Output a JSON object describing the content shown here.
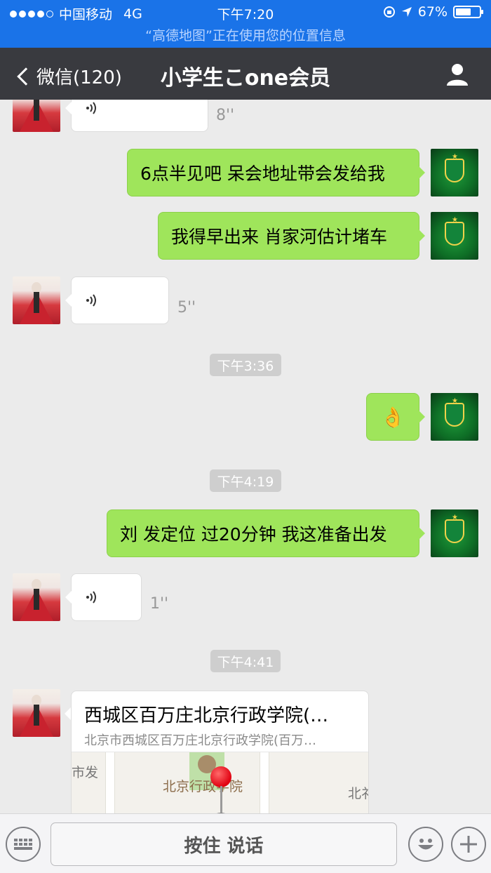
{
  "status_bar": {
    "carrier": "中国移动",
    "network": "4G",
    "time": "下午7:20",
    "battery": "67%",
    "battery_level": 0.67,
    "location_banner": "“高德地图”正在使用您的位置信息"
  },
  "nav": {
    "back_label": "微信(120)",
    "title": "小学生こone会员"
  },
  "messages": [
    {
      "id": "m1",
      "side": "left",
      "kind": "voice",
      "duration": "8''"
    },
    {
      "id": "m2",
      "side": "right",
      "kind": "text",
      "text": "6点半见吧 呆会地址带会发给我"
    },
    {
      "id": "m3",
      "side": "right",
      "kind": "text",
      "text": "我得早出来 肖家河估计堵车"
    },
    {
      "id": "m4",
      "side": "left",
      "kind": "voice",
      "duration": "5''"
    },
    {
      "id": "t1",
      "kind": "time",
      "text": "下午3:36"
    },
    {
      "id": "m5",
      "side": "right",
      "kind": "emoji",
      "text": "👌"
    },
    {
      "id": "t2",
      "kind": "time",
      "text": "下午4:19"
    },
    {
      "id": "m6",
      "side": "right",
      "kind": "text",
      "text": "刘 发定位 过20分钟 我这准备出发"
    },
    {
      "id": "m7",
      "side": "left",
      "kind": "voice",
      "duration": "1''"
    },
    {
      "id": "t3",
      "kind": "time",
      "text": "下午4:41"
    },
    {
      "id": "m8",
      "side": "left",
      "kind": "location",
      "title": "西城区百万庄北京行政学院(…",
      "address": "北京市西城区百万庄北京行政学院(百万…",
      "map_labels": [
        "北京行政学院",
        "市发",
        "北礻"
      ]
    }
  ],
  "input_bar": {
    "talk_label": "按住 说话"
  },
  "icons": {
    "back": "chevron-left-icon",
    "user": "user-icon",
    "voice": "voice-wave-icon",
    "keyboard": "keyboard-icon",
    "emoji": "emoji-icon",
    "plus": "plus-icon"
  },
  "colors": {
    "status_bar": "#1a73e8",
    "nav_bar": "#393a3f",
    "chat_bg": "#ebebeb",
    "bubble_green": "#9fe55b",
    "bubble_white": "#ffffff",
    "time_pill": "#cecece"
  }
}
